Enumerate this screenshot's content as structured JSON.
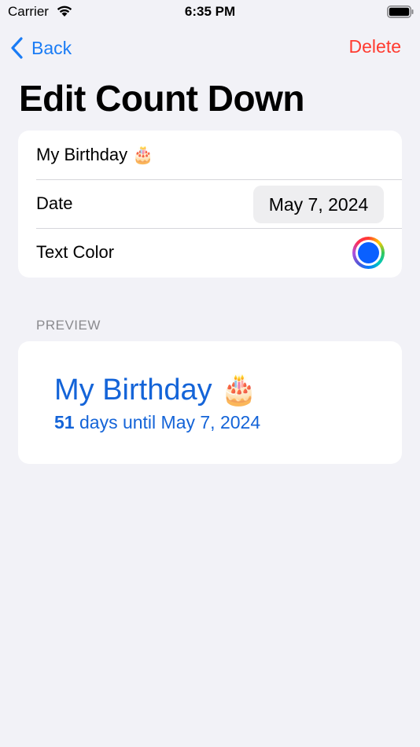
{
  "status_bar": {
    "carrier": "Carrier",
    "time": "6:35 PM"
  },
  "nav": {
    "back_label": "Back",
    "delete_label": "Delete"
  },
  "page": {
    "title": "Edit Count Down"
  },
  "form": {
    "name_value": "My Birthday 🎂",
    "date_label": "Date",
    "date_value": "May 7, 2024",
    "text_color_label": "Text Color",
    "selected_color": "#0a60ff"
  },
  "preview": {
    "header": "PREVIEW",
    "title": "My Birthday 🎂",
    "days_count": "51",
    "days_text": " days until May 7, 2024",
    "text_color": "#1464d8"
  },
  "colors": {
    "accent": "#1a7cf5",
    "destructive": "#ff3b30",
    "background": "#f2f2f7"
  }
}
